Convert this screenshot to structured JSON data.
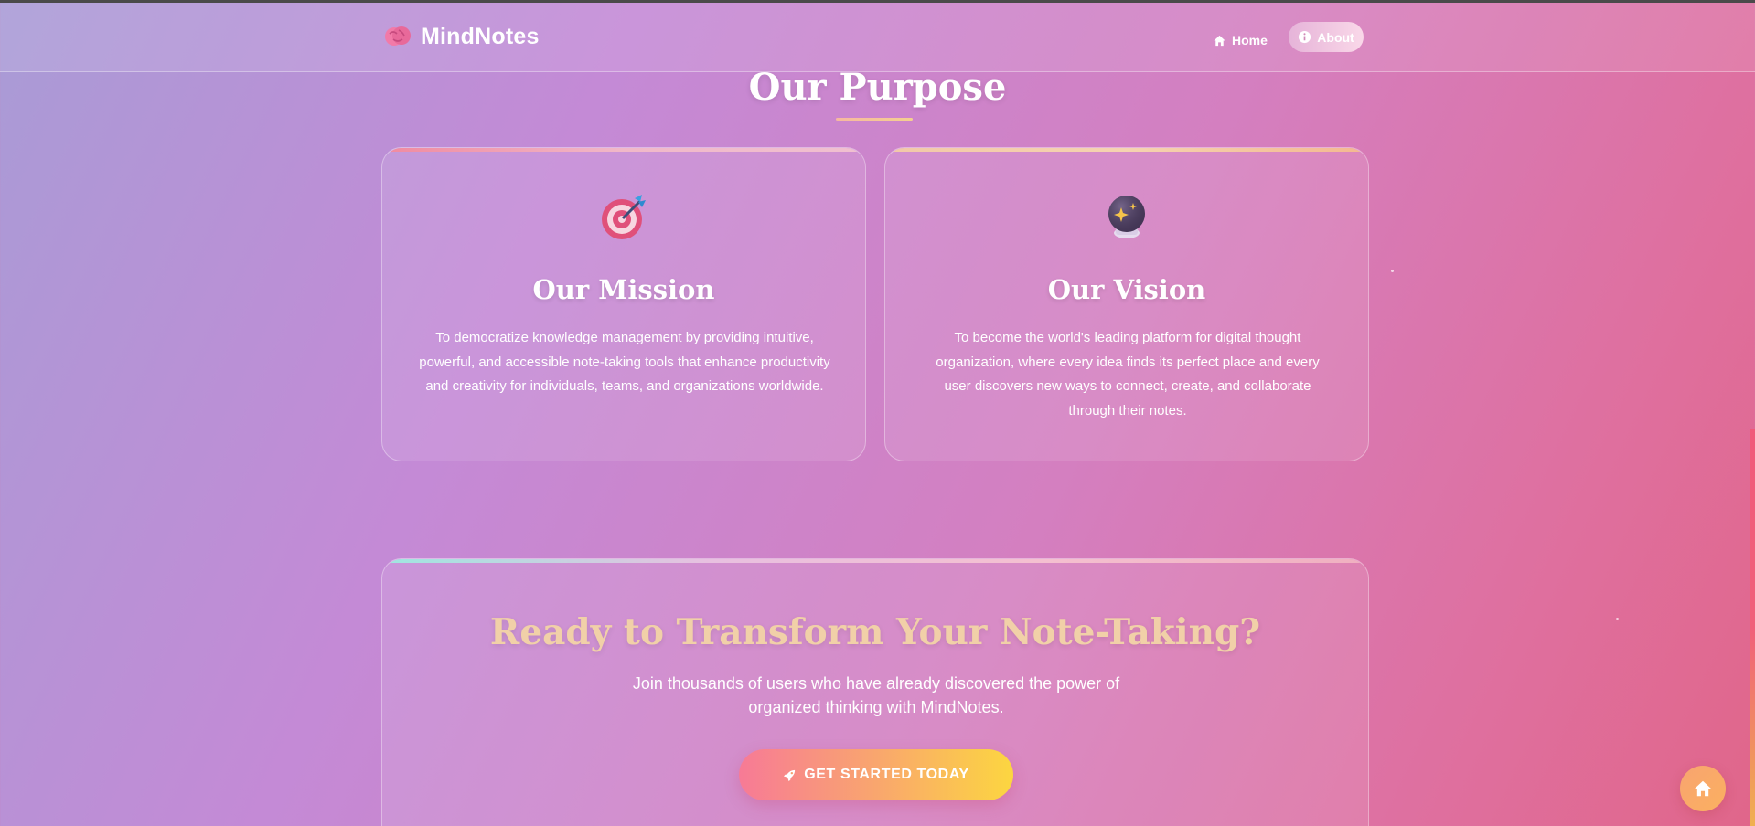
{
  "brand": {
    "name": "MindNotes",
    "icon": "brain-icon"
  },
  "nav": {
    "items": [
      {
        "label": "Home",
        "icon": "home-icon"
      },
      {
        "label": "About",
        "icon": "info-icon",
        "active": true
      }
    ]
  },
  "purpose": {
    "title": "Our Purpose",
    "cards": [
      {
        "title": "Our Mission",
        "icon": "target-icon",
        "text": "To democratize knowledge management by providing intuitive, powerful, and accessible note-taking tools that enhance productivity and creativity for individuals, teams, and organizations worldwide."
      },
      {
        "title": "Our Vision",
        "icon": "crystal-ball-icon",
        "text": "To become the world's leading platform for digital thought organization, where every idea finds its perfect place and every user discovers new ways to connect, create, and collaborate through their notes."
      }
    ]
  },
  "cta": {
    "title": "Ready to Transform Your Note-Taking?",
    "text": "Join thousands of users who have already discovered the power of organized thinking with MindNotes.",
    "button_label": "GET STARTED TODAY",
    "button_icon": "rocket-icon"
  },
  "fab": {
    "icon": "home-icon"
  },
  "colors": {
    "accent_gradient_start": "#f77a96",
    "accent_gradient_end": "#fcd640",
    "cta_title": "#f1d0a8"
  }
}
